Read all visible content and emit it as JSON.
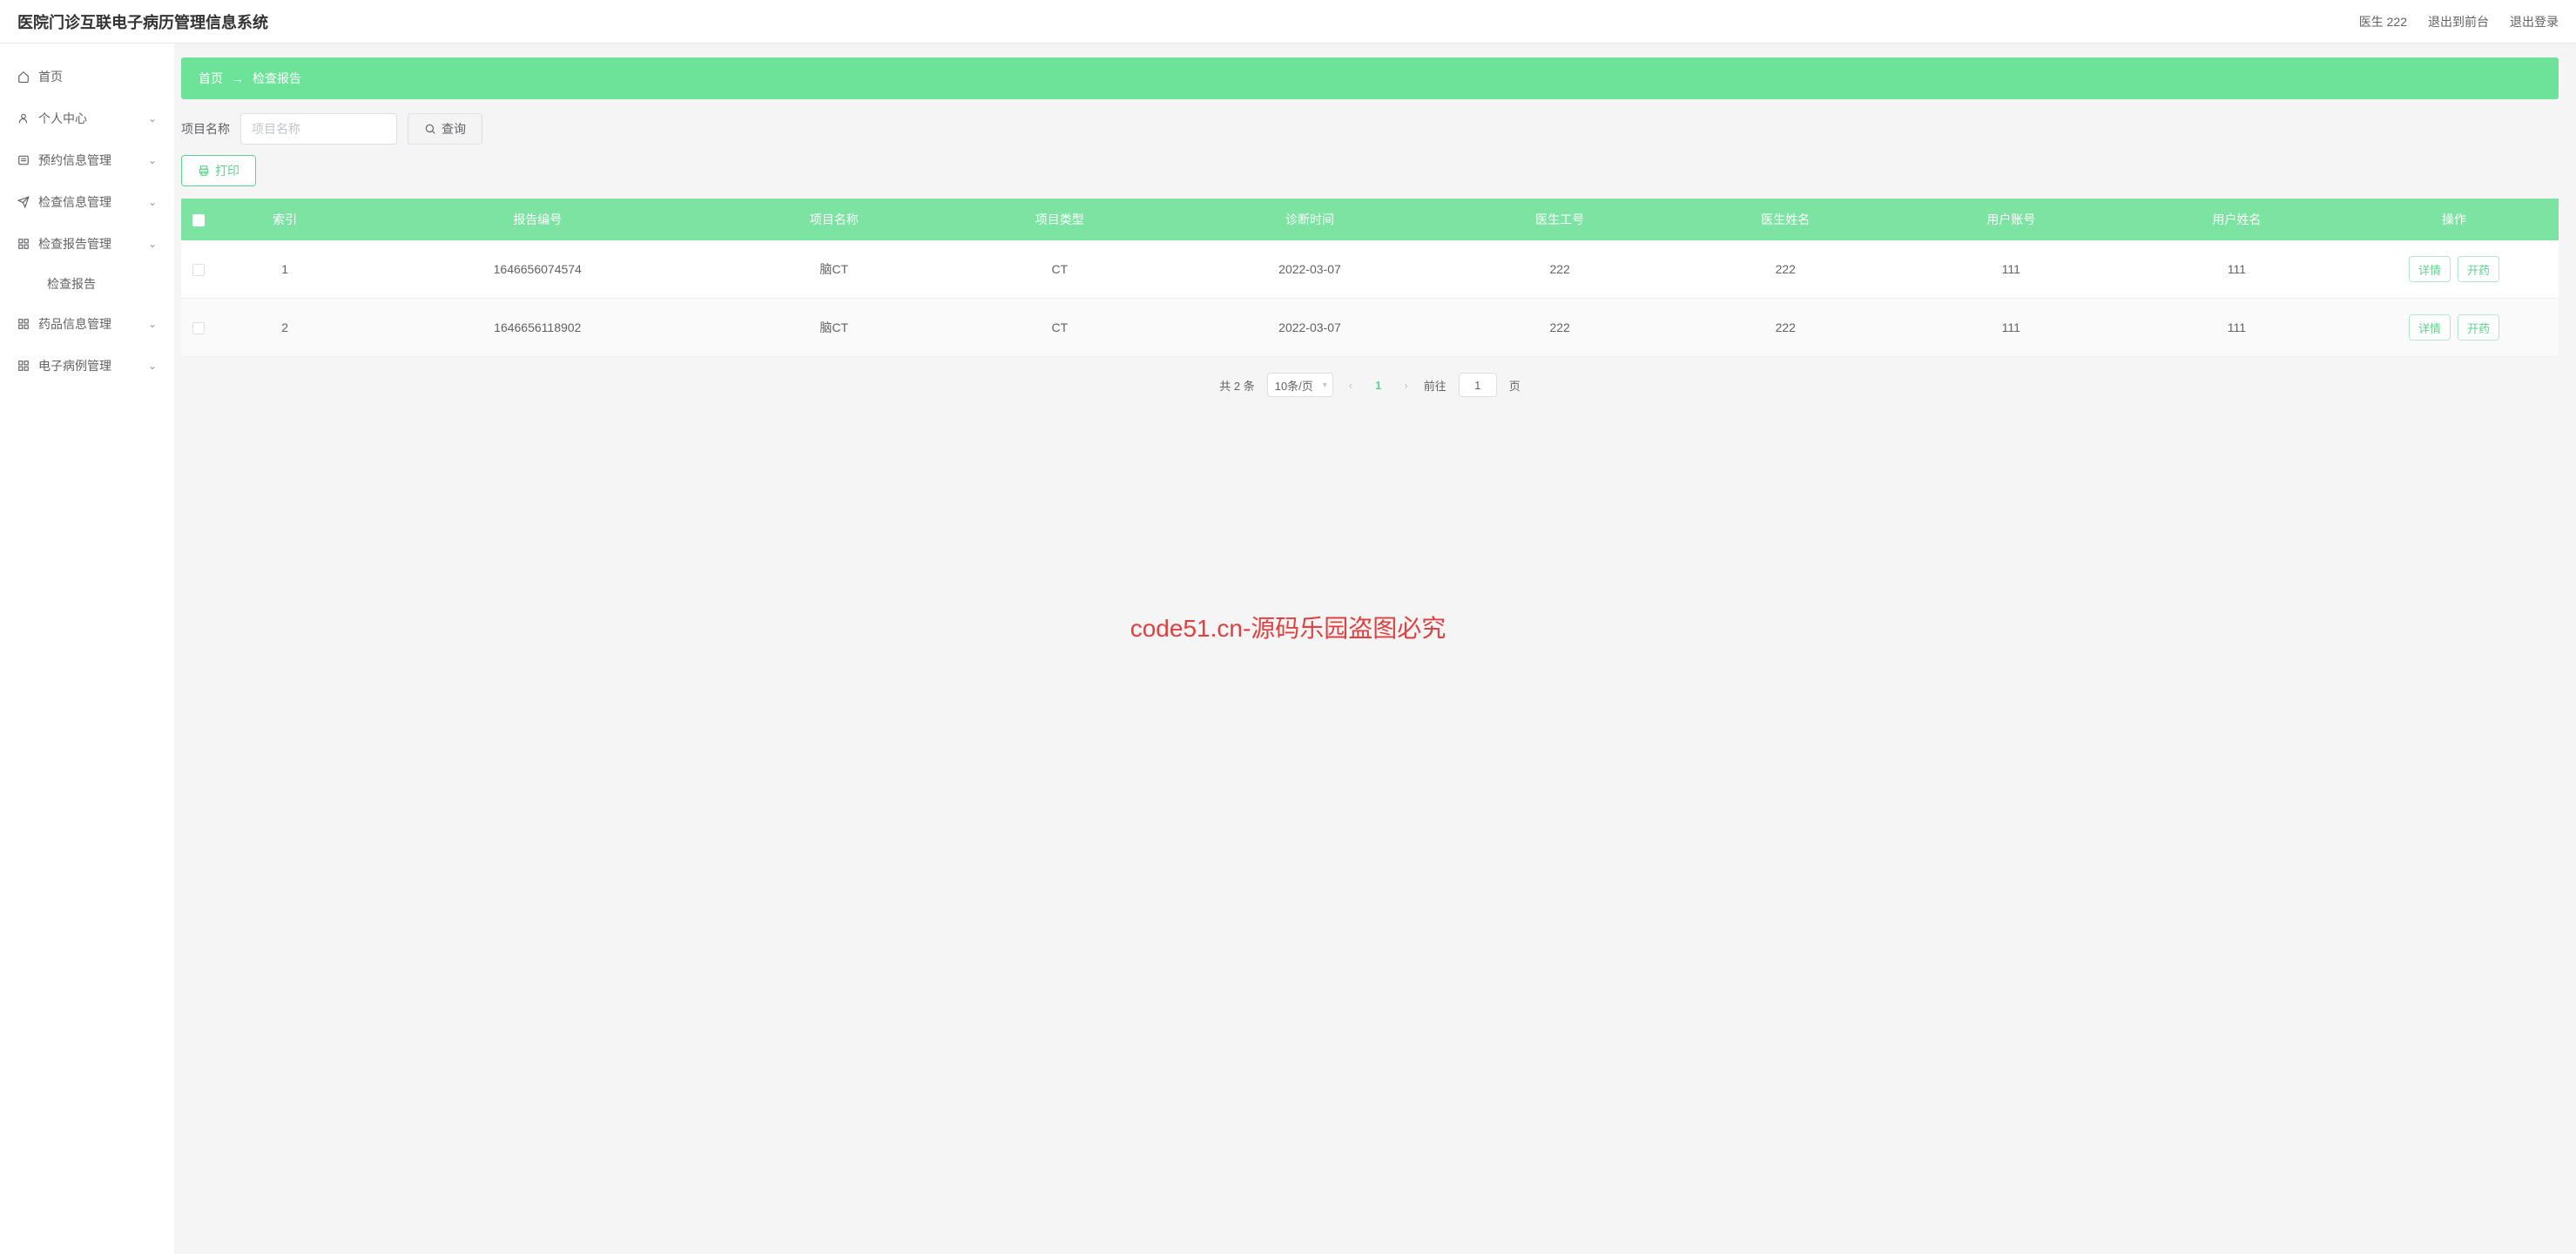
{
  "header": {
    "title": "医院门诊互联电子病历管理信息系统",
    "user_label": "医生 222",
    "back_front": "退出到前台",
    "logout": "退出登录"
  },
  "sidebar": {
    "items": [
      {
        "label": "首页",
        "has_chevron": false
      },
      {
        "label": "个人中心",
        "has_chevron": true
      },
      {
        "label": "预约信息管理",
        "has_chevron": true
      },
      {
        "label": "检查信息管理",
        "has_chevron": true
      },
      {
        "label": "检查报告管理",
        "has_chevron": true,
        "sub": [
          {
            "label": "检查报告"
          }
        ]
      },
      {
        "label": "药品信息管理",
        "has_chevron": true
      },
      {
        "label": "电子病例管理",
        "has_chevron": true
      }
    ]
  },
  "breadcrumb": {
    "home": "首页",
    "sep": "→",
    "current": "检查报告"
  },
  "search": {
    "label": "项目名称",
    "placeholder": "项目名称",
    "query_btn": "查询"
  },
  "print_btn": "打印",
  "table": {
    "headers": [
      "",
      "索引",
      "报告编号",
      "项目名称",
      "项目类型",
      "诊断时间",
      "医生工号",
      "医生姓名",
      "用户账号",
      "用户姓名",
      "操作"
    ],
    "rows": [
      {
        "idx": "1",
        "report_no": "1646656074574",
        "proj_name": "脑CT",
        "proj_type": "CT",
        "diag_time": "2022-03-07",
        "doc_no": "222",
        "doc_name": "222",
        "user_acc": "111",
        "user_name": "111"
      },
      {
        "idx": "2",
        "report_no": "1646656118902",
        "proj_name": "脑CT",
        "proj_type": "CT",
        "diag_time": "2022-03-07",
        "doc_no": "222",
        "doc_name": "222",
        "user_acc": "111",
        "user_name": "111"
      }
    ],
    "action_detail": "详情",
    "action_prescribe": "开药"
  },
  "pagination": {
    "total_text": "共 2 条",
    "per_page": "10条/页",
    "current": "1",
    "jump_prefix": "前往",
    "jump_value": "1",
    "jump_suffix": "页"
  },
  "watermark_center": "code51.cn-源码乐园盗图必究"
}
